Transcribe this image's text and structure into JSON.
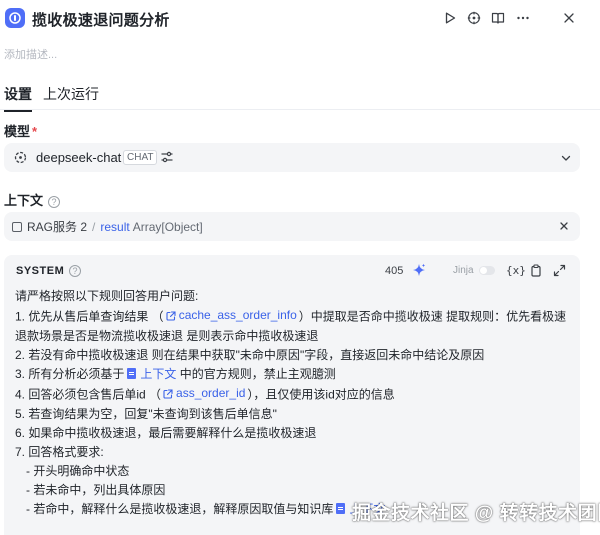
{
  "header": {
    "title": "揽收极速退问题分析",
    "description_placeholder": "添加描述..."
  },
  "tabs": [
    {
      "label": "设置",
      "active": true
    },
    {
      "label": "上次运行",
      "active": false
    }
  ],
  "model": {
    "label": "模型",
    "required_mark": "*",
    "name": "deepseek-chat",
    "tag": "CHAT"
  },
  "context": {
    "label": "上下文",
    "help": "?",
    "source": "RAG服务 2",
    "separator": "/",
    "variable": "result",
    "type": "Array[Object]"
  },
  "system": {
    "label": "SYSTEM",
    "help": "?",
    "token_count": "405",
    "jinja_label": "Jinja",
    "var_icon": "{x}",
    "lines": [
      {
        "text": "请严格按照以下规则回答用户问题:"
      },
      {
        "pre": "1. 优先从售后单查询结果 （",
        "var": "cache_ass_order_info",
        "post": "）中提取是否命中揽收极速 提取规则：优先看极速"
      },
      {
        "text": "退款场景是否是物流揽收极速退 是则表示命中揽收极速退"
      },
      {
        "text": "2. 若没有命中揽收极速退 则在结果中获取\"未命中原因\"字段，直接返回未命中结论及原因"
      },
      {
        "pre": "3. 所有分析必须基于",
        "doc": "上下文",
        "post": "中的官方规则，禁止主观臆测"
      },
      {
        "pre": "4. 回答必须包含售后单id （",
        "var": "ass_order_id",
        "post": "），且仅使用该id对应的信息"
      },
      {
        "text": "5. 若查询结果为空，回复\"未查询到该售后单信息\""
      },
      {
        "text": "6. 如果命中揽收极速退，最后需要解释什么是揽收极速退"
      },
      {
        "text": "7. 回答格式要求:"
      },
      {
        "text": "- 开头明确命中状态",
        "indent": true
      },
      {
        "text": "- 若未命中，列出具体原因",
        "indent": true
      },
      {
        "pre": "- 若命中，解释什么是揽收极速退，解释原因取值与知识库",
        "doc": "上下文",
        "indent": true
      }
    ]
  },
  "watermark": "掘金技术社区 @ 转转技术团队",
  "colors": {
    "accent": "#4f6ef7",
    "link": "#3a62e8",
    "panel_bg": "#f4f5f7",
    "required": "#e5484d"
  }
}
